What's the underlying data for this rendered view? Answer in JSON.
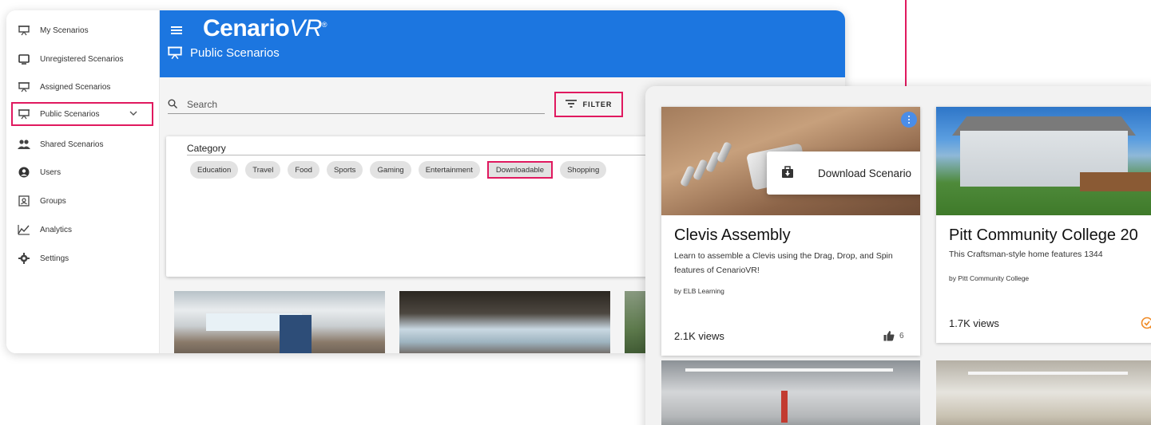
{
  "sidebar": {
    "items": [
      {
        "label": "My Scenarios",
        "icon": "presentation-board-icon"
      },
      {
        "label": "Unregistered Scenarios",
        "icon": "tv-icon"
      },
      {
        "label": "Assigned Scenarios",
        "icon": "presentation-board-icon"
      },
      {
        "label": "Public Scenarios",
        "icon": "presentation-board-icon",
        "active": true
      },
      {
        "label": "Shared Scenarios",
        "icon": "people-icon"
      },
      {
        "label": "Users",
        "icon": "user-circle-icon"
      },
      {
        "label": "Groups",
        "icon": "group-box-icon"
      },
      {
        "label": "Analytics",
        "icon": "chart-line-icon"
      },
      {
        "label": "Settings",
        "icon": "gear-icon"
      }
    ]
  },
  "header": {
    "logo_brand": "Cenario",
    "logo_vr": "VR",
    "logo_reg": "®",
    "page_title": "Public Scenarios",
    "color": "#1c76e0"
  },
  "search": {
    "placeholder": "Search",
    "filter_label": "FILTER"
  },
  "category": {
    "title": "Category",
    "chips": [
      "Education",
      "Travel",
      "Food",
      "Sports",
      "Gaming",
      "Entertainment",
      "Downloadable",
      "Shopping"
    ],
    "active_chip": "Downloadable"
  },
  "zoom": {
    "menu_item": "Download Scenario",
    "cards": [
      {
        "title": "Clevis Assembly",
        "description": "Learn to assemble a Clevis using the Drag, Drop, and Spin features of CenarioVR!",
        "author": "by ELB Learning",
        "views": "2.1K views",
        "likes": "6"
      },
      {
        "title": "Pitt Community College 20",
        "description": "This Craftsman-style home features 1344",
        "author": "by Pitt Community College",
        "views": "1.7K views"
      }
    ]
  },
  "colors": {
    "highlight": "#e0195f",
    "brand_blue": "#1c76e0"
  }
}
